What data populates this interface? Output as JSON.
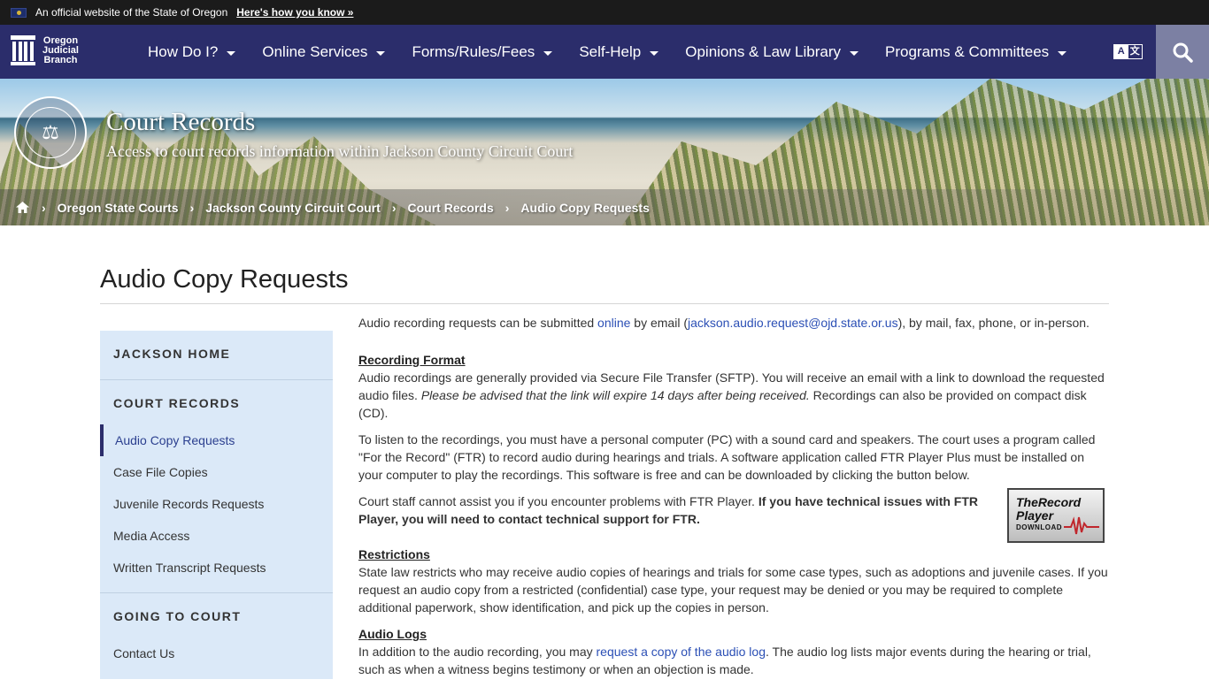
{
  "gov_banner": {
    "text": "An official website of the State of Oregon",
    "link": "Here's how you know »"
  },
  "logo": {
    "line1": "Oregon",
    "line2": "Judicial",
    "line3": "Branch"
  },
  "nav": {
    "items": [
      {
        "label": "How Do I?"
      },
      {
        "label": "Online Services"
      },
      {
        "label": "Forms/Rules/Fees"
      },
      {
        "label": "Self-Help"
      },
      {
        "label": "Opinions & Law Library"
      },
      {
        "label": "Programs & Committees"
      }
    ],
    "translate_a": "A",
    "translate_b": "文"
  },
  "hero": {
    "title": "Court Records",
    "subtitle": "Access to court records information within Jackson County Circuit Court"
  },
  "breadcrumb": {
    "items": [
      "Oregon State Courts",
      "Jackson County Circuit Court",
      "Court Records",
      "Audio Copy Requests"
    ]
  },
  "page": {
    "title": "Audio Copy Requests"
  },
  "sidebar": {
    "headings": [
      "JACKSON HOME",
      "COURT RECORDS",
      "GOING TO COURT"
    ],
    "links": [
      "Audio Copy Requests",
      "Case File Copies",
      "Juvenile Records Requests",
      "Media Access",
      "Written Transcript Requests",
      "Contact Us"
    ]
  },
  "content": {
    "intro_a": "Audio recording requests can be submitted ",
    "intro_link1": "online",
    "intro_b": " by email (",
    "intro_link2": "jackson.audio.request@ojd.state.or.us",
    "intro_c": "), by mail, fax, phone, or in-person.",
    "format_title": "Recording Format",
    "format_a": "Audio recordings are generally provided via Secure File Transfer (SFTP).  You will receive an email with a link to download the requested audio files.  ",
    "format_italic": "Please be advised that the link will expire 14 days after being received.",
    "format_b": "  Recordings can also be provided on compact disk (CD).",
    "listen_text": "To listen to the recordings, you must have a personal computer (PC) with a sound card and speakers.  The court uses a program called \"For the Record\" (FTR) to record audio during hearings and trials.  A software application called FTR Player Plus must be installed on your computer to play the recordings.  This software is free and can be downloaded by clicking the button below.",
    "ftr_text": "Court staff cannot assist you if you encounter problems with FTR Player. ",
    "ftr_bold": "If you have technical issues with FTR Player, you will need to contact technical support for FTR.",
    "ftr_badge_line1": "TheRecord",
    "ftr_badge_line2": "Player",
    "ftr_badge_dl": "DOWNLOAD",
    "restrictions_title": "Restrictions",
    "restrictions_text": "State law restricts who may receive audio copies of hearings and trials for some case types, such as adoptions and juvenile cases.  If you request an audio copy from a restricted (confidential) case type, your request may be denied or you may be required to complete additional paperwork, show identification, and pick up the copies in person.",
    "logs_title": "Audio Logs",
    "logs_a": "In addition to the audio recording, you may ",
    "logs_link": "request a copy of the audio log",
    "logs_b": ".  The audio log lists major events during the hearing or trial, such as when a witness begins testimony or when an objection is made."
  }
}
